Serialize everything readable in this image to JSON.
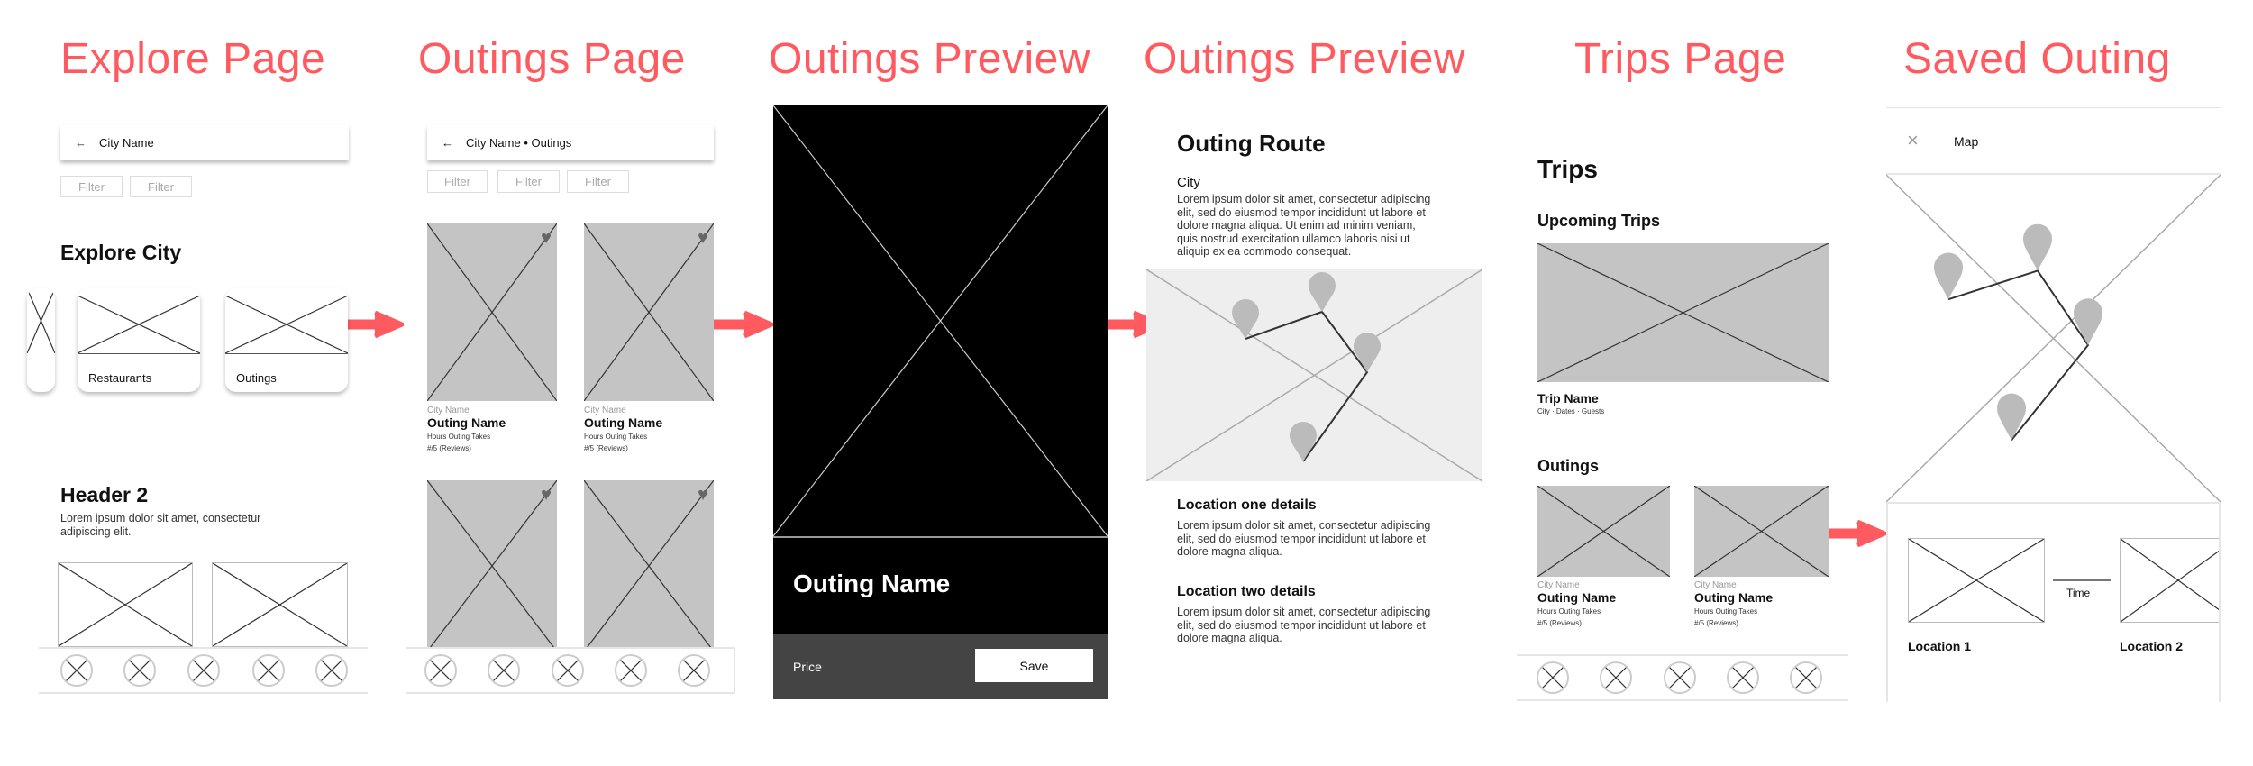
{
  "accent": "#ff5a5f",
  "titles": [
    "Explore Page",
    "Outings Page",
    "Outings Preview",
    "Outings Preview",
    "Trips Page",
    "Saved Outing"
  ],
  "explore": {
    "back_icon": "arrow-left-icon",
    "city_name": "City Name",
    "filters": [
      "Filter",
      "Filter"
    ],
    "section_title": "Explore City",
    "categories": [
      "Restaurants",
      "Outings"
    ],
    "header2": "Header 2",
    "body": "Lorem ipsum dolor sit amet, consectetur adipiscing elit."
  },
  "outings_page": {
    "breadcrumb_city": "City Name",
    "breadcrumb_sep": "•",
    "breadcrumb_page": "Outings",
    "filters": [
      "Filter",
      "Filter",
      "Filter"
    ],
    "cards": [
      {
        "city": "City Name",
        "name": "Outing Name",
        "hours": "Hours Outing Takes",
        "rating": "#/5 (Reviews)"
      },
      {
        "city": "City Name",
        "name": "Outing Name",
        "hours": "Hours Outing Takes",
        "rating": "#/5 (Reviews)"
      }
    ]
  },
  "preview": {
    "outing_name": "Outing Name",
    "price": "Price",
    "save": "Save"
  },
  "route": {
    "title": "Outing Route",
    "city": "City",
    "city_text": "Lorem ipsum dolor sit amet, consectetur adipiscing elit, sed do eiusmod tempor incididunt ut labore et dolore magna aliqua. Ut enim ad minim veniam, quis nostrud exercitation ullamco laboris nisi ut aliquip ex ea commodo consequat.",
    "loc1_title": "Location one details",
    "loc1_text": "Lorem ipsum dolor sit amet, consectetur adipiscing elit, sed do eiusmod tempor incididunt ut labore et dolore magna aliqua.",
    "loc2_title": "Location two details",
    "loc2_text": "Lorem ipsum dolor sit amet, consectetur adipiscing elit, sed do eiusmod tempor incididunt ut labore et dolore magna aliqua."
  },
  "trips": {
    "title": "Trips",
    "upcoming": "Upcoming Trips",
    "trip_name": "Trip Name",
    "trip_meta": "City · Dates · Guests",
    "outings": "Outings",
    "cards": [
      {
        "city": "City Name",
        "name": "Outing Name",
        "hours": "Hours Outing Takes",
        "rating": "#/5 (Reviews)"
      },
      {
        "city": "City Name",
        "name": "Outing Name",
        "hours": "Hours Outing Takes",
        "rating": "#/5 (Reviews)"
      }
    ]
  },
  "saved": {
    "close_icon": "close-icon",
    "map": "Map",
    "time": "Time",
    "loc1": "Location 1",
    "loc2": "Location 2"
  }
}
